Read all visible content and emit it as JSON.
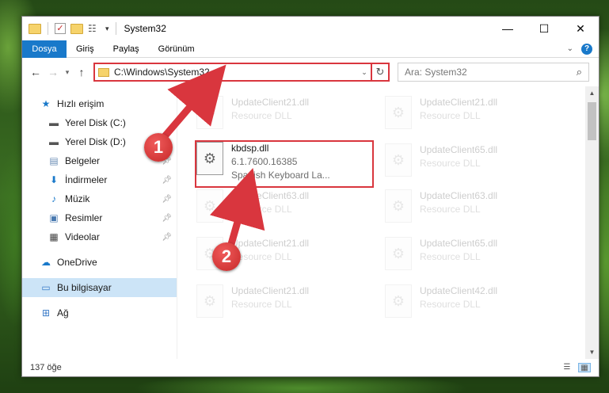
{
  "window": {
    "title": "System32",
    "controls": {
      "minimize": "—",
      "maximize": "☐",
      "close": "✕"
    }
  },
  "ribbon": {
    "tabs": [
      "Dosya",
      "Giriş",
      "Paylaş",
      "Görünüm"
    ],
    "help": "?"
  },
  "address": {
    "path": "C:\\Windows\\System32",
    "search_placeholder": "Ara: System32"
  },
  "sidebar": {
    "items": [
      {
        "label": "Hızlı erişim",
        "icon": "star-icon",
        "pinned": false
      },
      {
        "label": "Yerel Disk (C:)",
        "icon": "drive-icon",
        "pinned": false
      },
      {
        "label": "Yerel Disk (D:)",
        "icon": "drive-icon",
        "pinned": false
      },
      {
        "label": "Belgeler",
        "icon": "documents-icon",
        "pinned": true
      },
      {
        "label": "İndirmeler",
        "icon": "download-icon",
        "pinned": true
      },
      {
        "label": "Müzik",
        "icon": "music-icon",
        "pinned": true
      },
      {
        "label": "Resimler",
        "icon": "pictures-icon",
        "pinned": true
      },
      {
        "label": "Videolar",
        "icon": "video-icon",
        "pinned": true
      },
      {
        "label": "OneDrive",
        "icon": "cloud-icon",
        "pinned": false
      },
      {
        "label": "Bu bilgisayar",
        "icon": "computer-icon",
        "pinned": false
      },
      {
        "label": "Ağ",
        "icon": "network-icon",
        "pinned": false
      }
    ]
  },
  "files": {
    "selected": {
      "name": "kbdsp.dll",
      "version": "6.1.7600.16385",
      "desc": "Spanish Keyboard La..."
    },
    "left_col": [
      {
        "name": "UpdateClient21.dll",
        "desc": "Resource DLL"
      },
      {
        "name": "UpdateClient63.dll",
        "desc": "Resource DLL"
      },
      {
        "name": "UpdateClient21.dll",
        "desc": "Resource DLL"
      },
      {
        "name": "UpdateClient21.dll",
        "desc": "Resource DLL"
      }
    ],
    "right_col": [
      {
        "name": "UpdateClient21.dll",
        "desc": "Resource DLL"
      },
      {
        "name": "UpdateClient65.dll",
        "desc": "Resource DLL"
      },
      {
        "name": "UpdateClient63.dll",
        "desc": "Resource DLL"
      },
      {
        "name": "UpdateClient65.dll",
        "desc": "Resource DLL"
      },
      {
        "name": "UpdateClient42.dll",
        "desc": "Resource DLL"
      }
    ]
  },
  "status": {
    "count": "137 öğe"
  },
  "annotations": {
    "step1": "1",
    "step2": "2",
    "color": "#d9363e"
  }
}
